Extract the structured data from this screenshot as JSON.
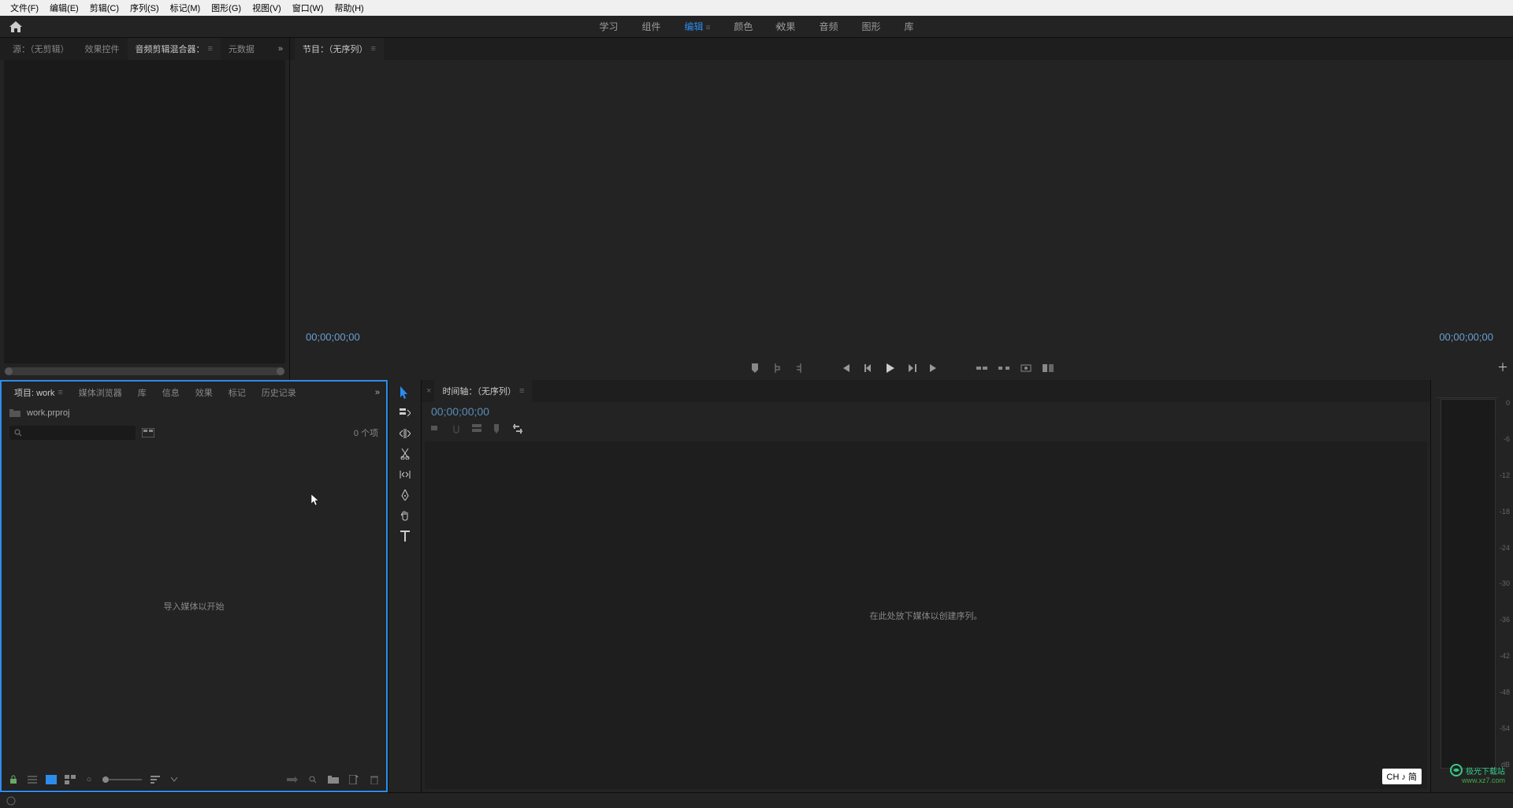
{
  "menu": {
    "file": "文件(F)",
    "edit": "编辑(E)",
    "clip": "剪辑(C)",
    "sequence": "序列(S)",
    "markers": "标记(M)",
    "graphics": "图形(G)",
    "view": "视图(V)",
    "window": "窗口(W)",
    "help": "帮助(H)"
  },
  "workspace": {
    "learning": "学习",
    "assembly": "组件",
    "editing": "编辑",
    "color": "颜色",
    "effects": "效果",
    "audio": "音频",
    "graphics": "图形",
    "library": "库"
  },
  "source_tabs": {
    "source": "源：（无剪辑）",
    "effect_controls": "效果控件",
    "audio_mixer": "音频剪辑混合器：",
    "metadata": "元数据"
  },
  "program_tab": "节目：（无序列）",
  "timecode_left": "00;00;00;00",
  "timecode_right": "00;00;00;00",
  "project_tabs": {
    "project": "项目: work",
    "media_browser": "媒体浏览器",
    "library": "库",
    "info": "信息",
    "effects": "效果",
    "markers": "标记",
    "history": "历史记录"
  },
  "project_file": "work.prproj",
  "item_count": "0 个项",
  "project_empty": "导入媒体以开始",
  "timeline_tab": "时间轴：（无序列）",
  "timeline_tc": "00;00;00;00",
  "timeline_empty": "在此处放下媒体以创建序列。",
  "meter_ticks": [
    "0",
    "-6",
    "-12",
    "-18",
    "-24",
    "-30",
    "-36",
    "-42",
    "-48",
    "-54",
    "dB"
  ],
  "ime": "CH ♪ 简",
  "watermark_title": "极光下载站",
  "watermark_url": "www.xz7.com"
}
